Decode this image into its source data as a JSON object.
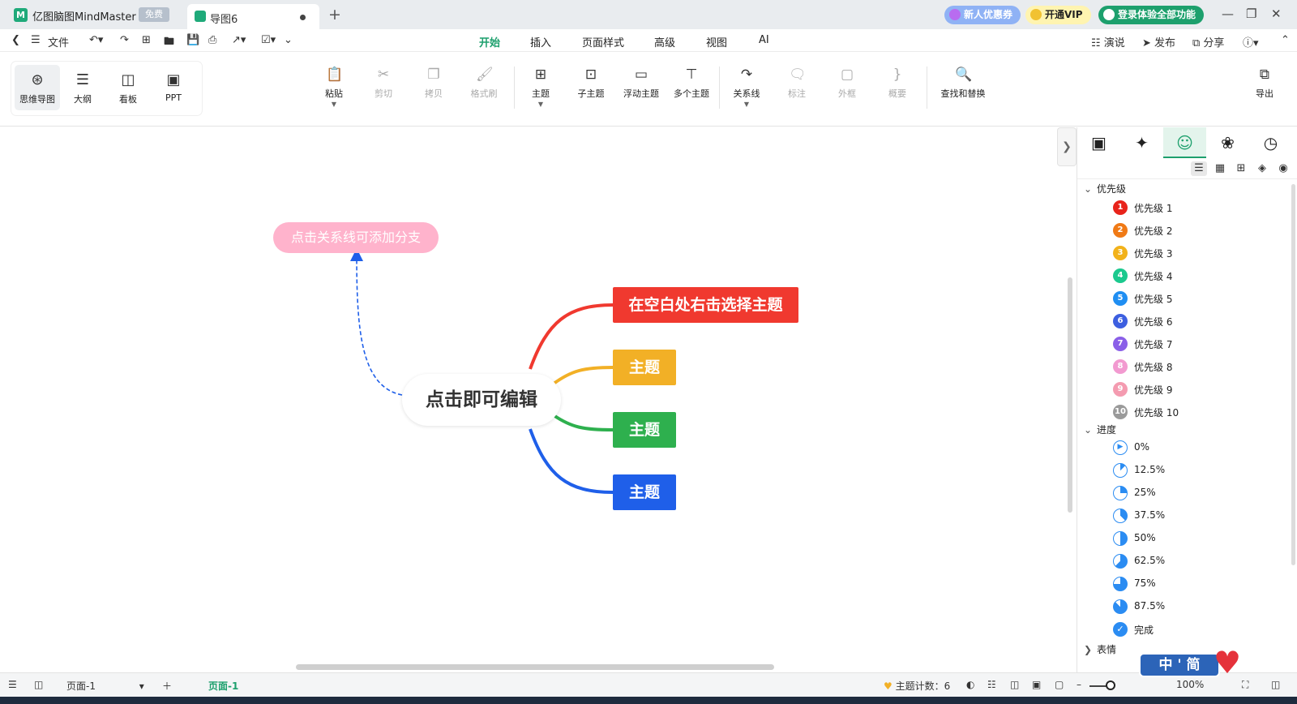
{
  "titlebar": {
    "app_title": "亿图脑图MindMaster",
    "app_badge": "免费",
    "doc_tab": "导图6",
    "promo_coupon": "新人优惠券",
    "promo_vip": "开通VIP",
    "promo_login": "登录体验全部功能"
  },
  "menubar": {
    "file": "文件",
    "tabs": [
      "开始",
      "插入",
      "页面样式",
      "高级",
      "视图",
      "AI"
    ],
    "present": "演说",
    "publish": "发布",
    "share": "分享"
  },
  "views": [
    "思维导图",
    "大纲",
    "看板",
    "PPT"
  ],
  "ribbon": {
    "paste": "粘贴",
    "cut": "剪切",
    "copy": "拷贝",
    "format_painter": "格式刷",
    "topic": "主题",
    "subtopic": "子主题",
    "floating_topic": "浮动主题",
    "multiple_topics": "多个主题",
    "relationship": "关系线",
    "callout": "标注",
    "boundary": "外框",
    "summary": "概要",
    "find_replace": "查找和替换",
    "export": "导出"
  },
  "mindmap": {
    "central": "点击即可编辑",
    "floating": "点击关系线可添加分支",
    "branches": [
      {
        "label": "在空白处右击选择主题",
        "color": "#f0392f"
      },
      {
        "label": "主题",
        "color": "#f2b026"
      },
      {
        "label": "主题",
        "color": "#2eb04e"
      },
      {
        "label": "主题",
        "color": "#1f5fe9"
      }
    ],
    "relationship_color": "#1f5fe9"
  },
  "panel": {
    "priority_title": "优先级",
    "priorities": [
      {
        "label": "优先级 1",
        "num": "1",
        "color": "#e8231b"
      },
      {
        "label": "优先级 2",
        "num": "2",
        "color": "#f07a16"
      },
      {
        "label": "优先级 3",
        "num": "3",
        "color": "#f2b21a"
      },
      {
        "label": "优先级 4",
        "num": "4",
        "color": "#1bc98e"
      },
      {
        "label": "优先级 5",
        "num": "5",
        "color": "#1f8ef2"
      },
      {
        "label": "优先级 6",
        "num": "6",
        "color": "#3d5fe0"
      },
      {
        "label": "优先级 7",
        "num": "7",
        "color": "#8a5fe8"
      },
      {
        "label": "优先级 8",
        "num": "8",
        "color": "#f29ad0"
      },
      {
        "label": "优先级 9",
        "num": "9",
        "color": "#f49bb0"
      },
      {
        "label": "优先级 10",
        "num": "10",
        "color": "#9a9a9a"
      }
    ],
    "progress_title": "进度",
    "progress": [
      {
        "label": "0%",
        "value": 0
      },
      {
        "label": "12.5%",
        "value": 0.125
      },
      {
        "label": "25%",
        "value": 0.25
      },
      {
        "label": "37.5%",
        "value": 0.375
      },
      {
        "label": "50%",
        "value": 0.5
      },
      {
        "label": "62.5%",
        "value": 0.625
      },
      {
        "label": "75%",
        "value": 0.75
      },
      {
        "label": "87.5%",
        "value": 0.875
      },
      {
        "label": "完成",
        "value": 1
      }
    ],
    "emoji_title": "表情"
  },
  "statusbar": {
    "page_select": "页面-1",
    "page_tab": "页面-1",
    "topic_count_label": "主题计数：",
    "topic_count": "6",
    "zoom": "100%"
  },
  "watermark": {
    "text": "中 ' 简"
  }
}
